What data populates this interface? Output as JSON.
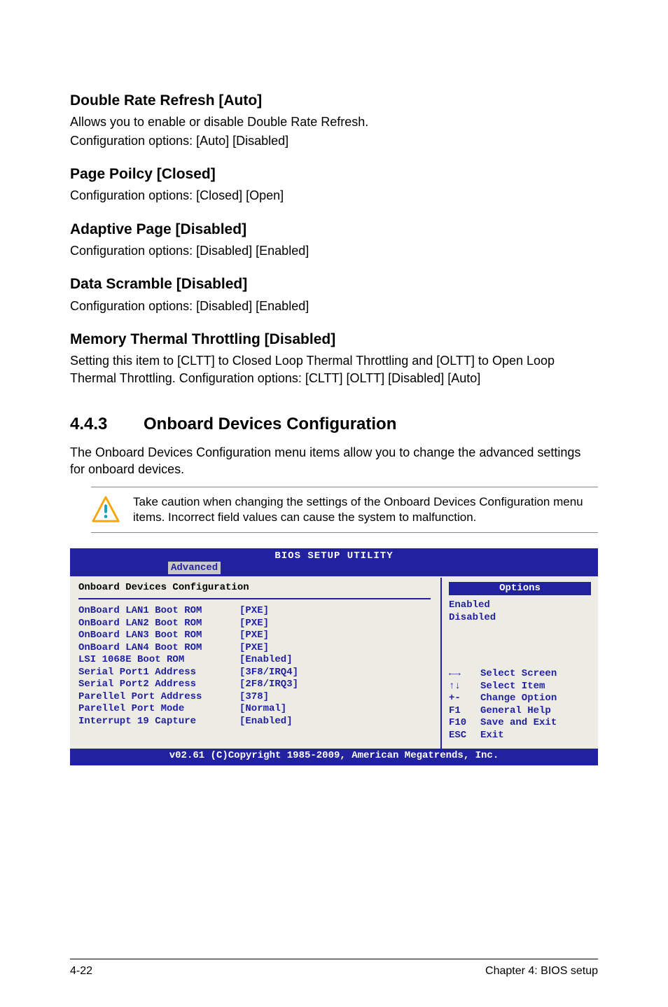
{
  "sections": {
    "s1": {
      "title": "Double Rate Refresh [Auto]",
      "p1": "Allows you to enable or disable Double Rate Refresh.",
      "p2": "Configuration options: [Auto] [Disabled]"
    },
    "s2": {
      "title": "Page Poilcy [Closed]",
      "p1": "Configuration options: [Closed] [Open]"
    },
    "s3": {
      "title": "Adaptive Page [Disabled]",
      "p1": "Configuration options: [Disabled] [Enabled]"
    },
    "s4": {
      "title": "Data Scramble [Disabled]",
      "p1": "Configuration options: [Disabled] [Enabled]"
    },
    "s5": {
      "title": "Memory Thermal Throttling [Disabled]",
      "p1": "Setting this item to [CLTT] to Closed Loop Thermal Throttling and [OLTT] to Open Loop Thermal Throttling. Configuration options: [CLTT] [OLTT] [Disabled] [Auto]"
    }
  },
  "main_heading": {
    "num": "4.4.3",
    "text": "Onboard Devices Configuration"
  },
  "main_para": "The Onboard Devices Configuration menu items allow you to change the advanced settings for onboard devices.",
  "note": "Take caution when changing the settings of the Onboard Devices Configuration menu items. Incorrect field values can cause the system to malfunction.",
  "bios": {
    "title": "BIOS SETUP UTILITY",
    "tab": "Advanced",
    "panel_title": "Onboard Devices Configuration",
    "rows": [
      {
        "label": "OnBoard LAN1 Boot ROM",
        "value": "[PXE]"
      },
      {
        "label": "OnBoard LAN2 Boot ROM",
        "value": "[PXE]"
      },
      {
        "label": "OnBoard LAN3 Boot ROM",
        "value": "[PXE]"
      },
      {
        "label": "OnBoard LAN4 Boot ROM",
        "value": "[PXE]"
      },
      {
        "label": "LSI 1068E Boot ROM",
        "value": "[Enabled]"
      },
      {
        "label": "Serial Port1 Address",
        "value": "[3F8/IRQ4]"
      },
      {
        "label": "Serial Port2 Address",
        "value": "[2F8/IRQ3]"
      },
      {
        "label": "Parellel Port Address",
        "value": "[378]"
      },
      {
        "label": "Parellel Port Mode",
        "value": "[Normal]"
      },
      {
        "label": "Interrupt 19 Capture",
        "value": "[Enabled]"
      }
    ],
    "options_header": "Options",
    "options": [
      "Enabled",
      "Disabled"
    ],
    "help": [
      {
        "key": "←→",
        "text": "Select Screen"
      },
      {
        "key": "↑↓",
        "text": "Select Item"
      },
      {
        "key": "+-",
        "text": "Change Option"
      },
      {
        "key": "F1",
        "text": "General Help"
      },
      {
        "key": "F10",
        "text": "Save and Exit"
      },
      {
        "key": "ESC",
        "text": "Exit"
      }
    ],
    "footer": "v02.61 (C)Copyright 1985-2009, American Megatrends, Inc."
  },
  "footer": {
    "left": "4-22",
    "right": "Chapter 4: BIOS setup"
  }
}
